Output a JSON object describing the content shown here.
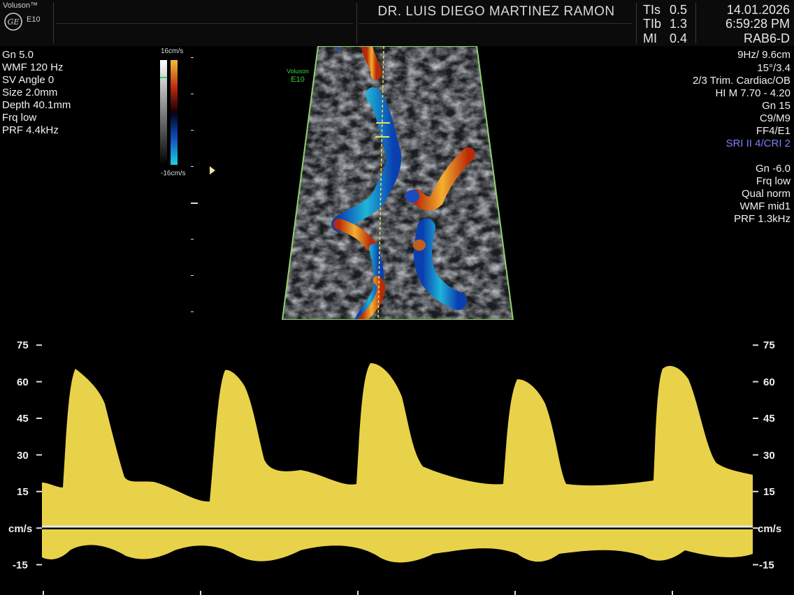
{
  "header": {
    "brand": "Voluson™",
    "model": "E10",
    "doctor": "DR. LUIS DIEGO MARTINEZ RAMON",
    "indices": [
      {
        "label": "TIs",
        "value": "0.5"
      },
      {
        "label": "TIb",
        "value": "1.3"
      },
      {
        "label": "MI",
        "value": "0.4"
      }
    ],
    "date": "14.01.2026",
    "time": "6:59:28 PM",
    "probe": "RAB6-D"
  },
  "left_params": [
    "Gn  5.0",
    "WMF 120 Hz",
    "SV Angle  0",
    "Size  2.0mm",
    "Depth 40.1mm",
    "Frq low",
    "PRF  4.4kHz"
  ],
  "color_scale": {
    "top": "16cm/s",
    "bottom": "-16cm/s"
  },
  "image_watermark": {
    "line1": "Voluson",
    "line2": "E10"
  },
  "right_params": {
    "frame": "9Hz/ 9.6cm",
    "lines": [
      "15°/3.4",
      "2/3 Trim. Cardiac/OB",
      "HI M  7.70 - 4.20",
      "Gn  15",
      "C9/M9",
      "FF4/E1"
    ],
    "sri": "SRI II 4/CRI 2",
    "doppler": [
      "Gn -6.0",
      "Frq low",
      "Qual norm",
      "WMF mid1",
      "PRF  1.3kHz"
    ]
  },
  "spectrum": {
    "unit": "cm/s",
    "ticks": [
      "75",
      "60",
      "45",
      "30",
      "15",
      "-15"
    ]
  },
  "colors": {
    "spectrum": "#e8d24a",
    "baseline": "#cfcfcf",
    "sri": "#7f7fff",
    "sector_border": "#8fd16a"
  }
}
